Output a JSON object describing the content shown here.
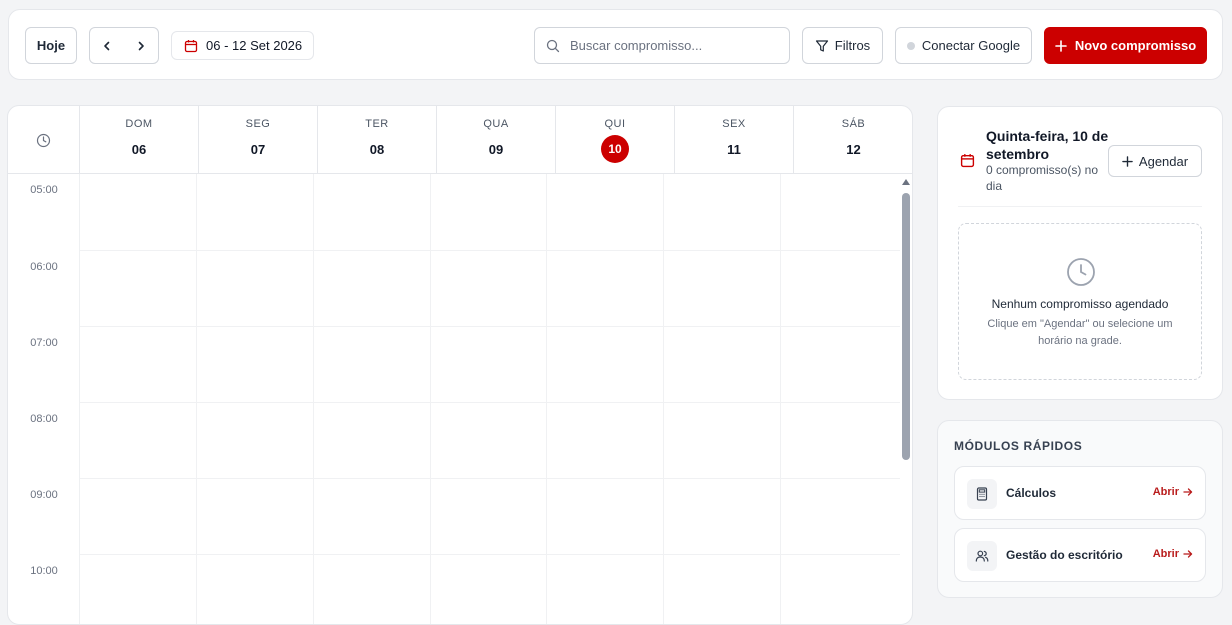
{
  "toolbar": {
    "today_label": "Hoje",
    "date_range": "06 - 12 Set 2026",
    "search_placeholder": "Buscar compromisso...",
    "filters_label": "Filtros",
    "google_label": "Conectar Google",
    "new_label": "Novo compromisso"
  },
  "calendar": {
    "days": [
      {
        "name": "DOM",
        "num": "06"
      },
      {
        "name": "SEG",
        "num": "07"
      },
      {
        "name": "TER",
        "num": "08"
      },
      {
        "name": "QUA",
        "num": "09"
      },
      {
        "name": "QUI",
        "num": "10",
        "today": true
      },
      {
        "name": "SEX",
        "num": "11"
      },
      {
        "name": "SÁB",
        "num": "12"
      }
    ],
    "hours": [
      "05:00",
      "06:00",
      "07:00",
      "08:00",
      "09:00",
      "10:00"
    ]
  },
  "day_panel": {
    "title": "Quinta-feira, 10 de setembro",
    "subtitle": "0 compromisso(s) no dia",
    "schedule_label": "Agendar",
    "empty_title": "Nenhum compromisso agendado",
    "empty_text": "Clique em \"Agendar\" ou selecione um horário na grade."
  },
  "modules": {
    "heading": "MÓDULOS RÁPIDOS",
    "items": [
      {
        "label": "Cálculos",
        "action": "Abrir",
        "icon": "calculator-icon"
      },
      {
        "label": "Gestão do escritório",
        "action": "Abrir",
        "icon": "users-icon"
      }
    ]
  },
  "colors": {
    "accent": "#cc0000",
    "link": "#b91c1c"
  }
}
